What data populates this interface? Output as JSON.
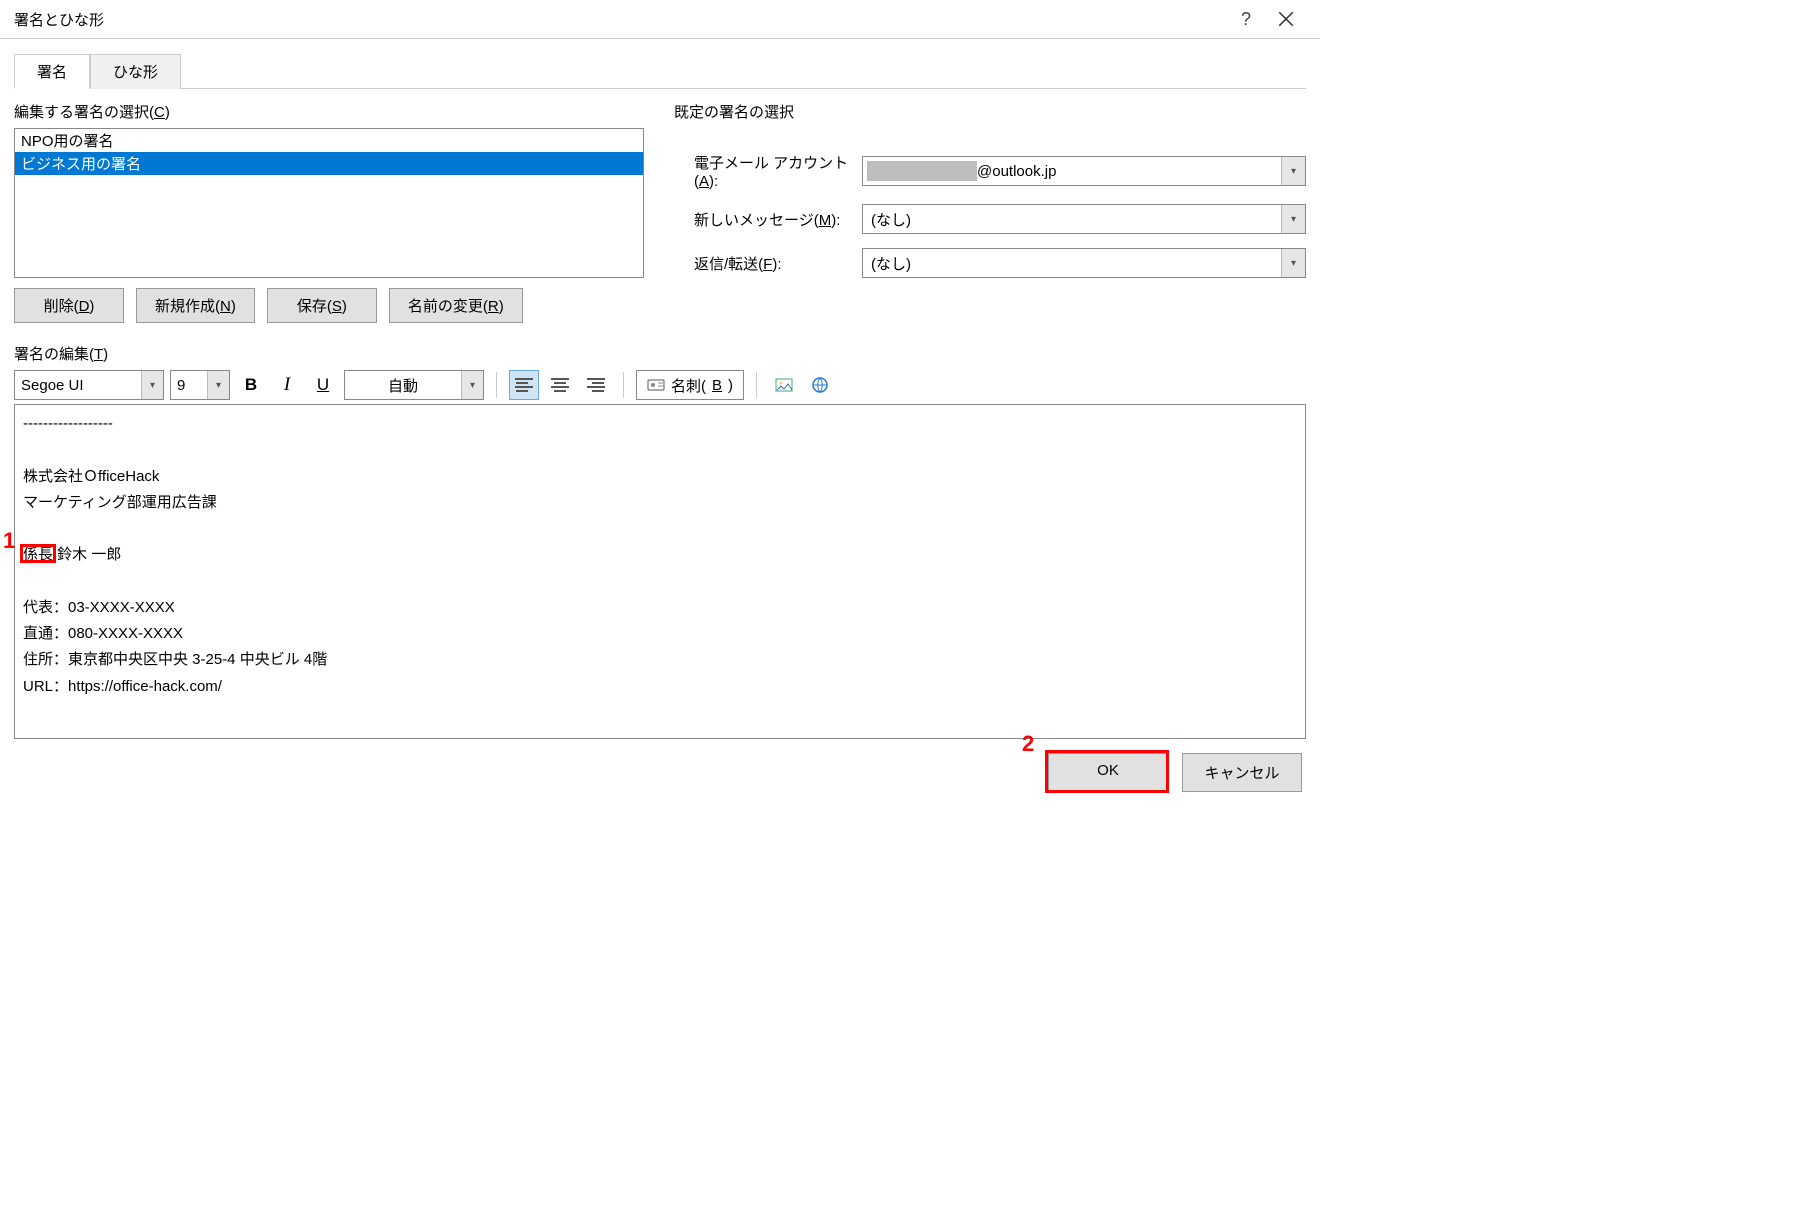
{
  "title": "署名とひな形",
  "tabs": {
    "signature": "署名",
    "stationery": "ひな形"
  },
  "left": {
    "select_label_pre": "編集する署名の選択(",
    "select_label_u": "C",
    "select_label_post": ")",
    "items": [
      "NPO用の署名",
      "ビジネス用の署名"
    ],
    "buttons": {
      "delete_pre": "削除(",
      "delete_u": "D",
      "delete_post": ")",
      "new_pre": "新規作成(",
      "new_u": "N",
      "new_post": ")",
      "save_pre": "保存(",
      "save_u": "S",
      "save_post": ")",
      "rename_pre": "名前の変更(",
      "rename_u": "R",
      "rename_post": ")"
    }
  },
  "right": {
    "header": "既定の署名の選択",
    "account_pre": "電子メール アカウント(",
    "account_u": "A",
    "account_post": "):",
    "account_value": "@outlook.jp",
    "newmsg_pre": "新しいメッセージ(",
    "newmsg_u": "M",
    "newmsg_post": "):",
    "newmsg_value": "(なし)",
    "reply_pre": "返信/転送(",
    "reply_u": "F",
    "reply_post": "):",
    "reply_value": "(なし)"
  },
  "edit": {
    "label_pre": "署名の編集(",
    "label_u": "T",
    "label_post": ")",
    "font_name": "Segoe UI",
    "font_size": "9",
    "color_label": "自動",
    "meishi_pre": "名刺(",
    "meishi_u": "B",
    "meishi_post": ")",
    "content_pre": "------------------\n\n株式会社ＯfficeHack\nマーケティング部運用広告課\n\n",
    "content_box": "係長",
    "content_post": " 鈴木 一郎\n\n代表：03-XXXX-XXXX\n直通：080-XXXX-XXXX\n住所：東京都中央区中央 3-25-4 中央ビル 4階\nURL：https://office-hack.com/\n\n------------------"
  },
  "footer": {
    "ok": "OK",
    "cancel": "キャンセル"
  },
  "callouts": {
    "one": "1",
    "two": "2"
  }
}
